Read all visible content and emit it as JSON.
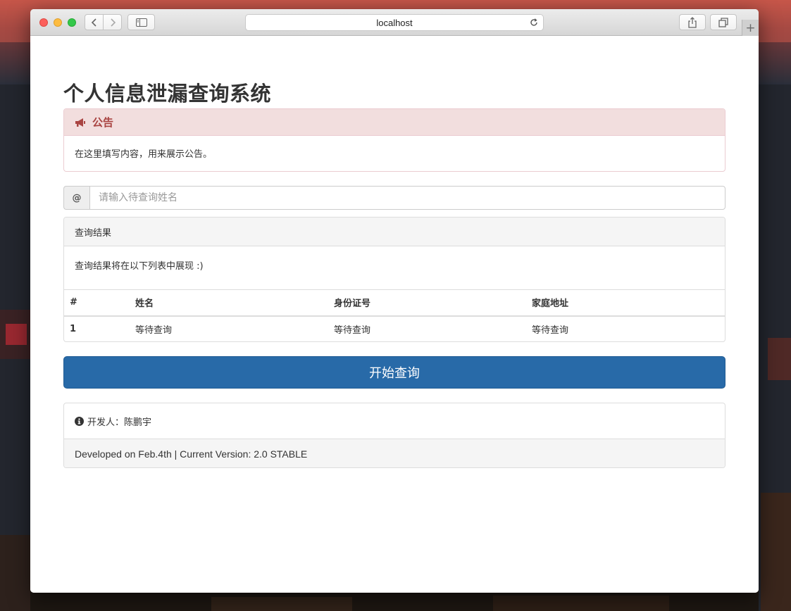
{
  "browser": {
    "url": "localhost"
  },
  "page": {
    "title": "个人信息泄漏查询系统",
    "notice": {
      "heading": "公告",
      "body": "在这里填写内容，用来展示公告。"
    },
    "search": {
      "addon": "@",
      "placeholder": "请输入待查询姓名",
      "value": ""
    },
    "results": {
      "heading": "查询结果",
      "description": "查询结果将在以下列表中展现 :)",
      "columns": [
        "#",
        "姓名",
        "身份证号",
        "家庭地址"
      ],
      "rows": [
        [
          "1",
          "等待查询",
          "等待查询",
          "等待查询"
        ]
      ]
    },
    "start_button": "开始查询",
    "footer": {
      "developer": "开发人：陈鹏宇",
      "version_line": "Developed on Feb.4th | Current Version: 2.0 STABLE"
    }
  },
  "colors": {
    "primary": "#286aa8",
    "notice_bg": "#f2dede",
    "notice_text": "#a94442"
  }
}
